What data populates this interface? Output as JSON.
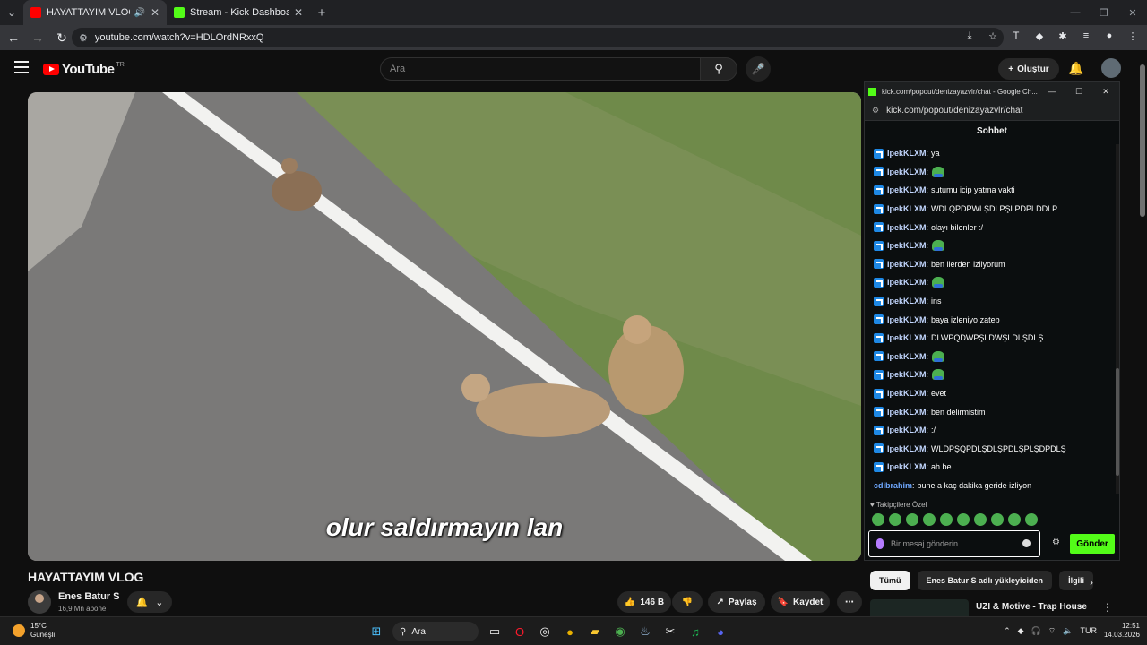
{
  "browser": {
    "tabs": [
      {
        "title": "HAYATTAYIM VLOG - YouTube",
        "active": true
      },
      {
        "title": "Stream - Kick Dashboard",
        "active": false
      }
    ],
    "url": "youtube.com/watch?v=HDLOrdNRxxQ"
  },
  "youtube": {
    "logo_text": "YouTube",
    "country": "TR",
    "search_placeholder": "Ara",
    "create_label": "Oluştur",
    "video": {
      "subtitle": "olur saldırmayın lan",
      "title": "HAYATTAYIM VLOG",
      "channel": "Enes Batur S",
      "subscribers": "16,9 Mn abone",
      "likes": "146 B",
      "share_label": "Paylaş",
      "save_label": "Kaydet"
    },
    "chips": [
      "Tümü",
      "Enes Batur S adlı yükleyiciden",
      "İlgili"
    ],
    "recommendation": {
      "title": "UZI & Motive - Trap House"
    }
  },
  "kick": {
    "window_title": "kick.com/popout/denizayazvlr/chat - Google Ch...",
    "url": "kick.com/popout/denizayazvlr/chat",
    "header": "Sohbet",
    "messages": [
      {
        "user": "IpekKLXM",
        "text": "ya",
        "emote": false
      },
      {
        "user": "IpekKLXM",
        "text": "",
        "emote": true
      },
      {
        "user": "IpekKLXM",
        "text": "sutumu icip yatma vakti",
        "emote": false
      },
      {
        "user": "IpekKLXM",
        "text": "WDLQPDPWLŞDLPŞLPDPLDDLP",
        "emote": false
      },
      {
        "user": "IpekKLXM",
        "text": "olayı bilenler :/",
        "emote": false
      },
      {
        "user": "IpekKLXM",
        "text": "",
        "emote": true
      },
      {
        "user": "IpekKLXM",
        "text": "ben ilerden izliyorum",
        "emote": false
      },
      {
        "user": "IpekKLXM",
        "text": "",
        "emote": true
      },
      {
        "user": "IpekKLXM",
        "text": "ins",
        "emote": false
      },
      {
        "user": "IpekKLXM",
        "text": "baya izleniyo zateb",
        "emote": false
      },
      {
        "user": "IpekKLXM",
        "text": "DLWPQDWPŞLDWŞLDLŞDLŞ",
        "emote": false
      },
      {
        "user": "IpekKLXM",
        "text": "",
        "emote": true
      },
      {
        "user": "IpekKLXM",
        "text": "",
        "emote": true
      },
      {
        "user": "IpekKLXM",
        "text": "evet",
        "emote": false
      },
      {
        "user": "IpekKLXM",
        "text": "ben delirmistim",
        "emote": false
      },
      {
        "user": "IpekKLXM",
        "text": ":/",
        "emote": false
      },
      {
        "user": "IpekKLXM",
        "text": "WLDPŞQPDLŞDLŞPDLŞPLŞDPDLŞ",
        "emote": false
      },
      {
        "user": "IpekKLXM",
        "text": "ah be",
        "emote": false
      },
      {
        "user": "cdibrahim",
        "text": "bune a kaç dakika geride izliyon",
        "emote": false
      }
    ],
    "sub_emotes_label": "Takipçilere Özel",
    "input_placeholder": "Bir mesaj gönderin",
    "send_label": "Gönder"
  },
  "taskbar": {
    "temp": "15°C",
    "weather": "Güneşli",
    "search": "Ara",
    "lang": "TUR",
    "time": "12:51",
    "date": "14.03.2026"
  }
}
